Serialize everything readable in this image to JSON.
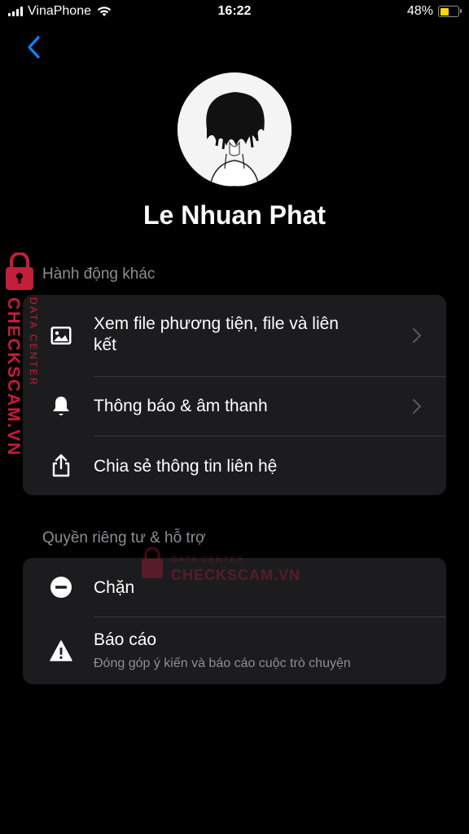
{
  "status_bar": {
    "carrier": "VinaPhone",
    "time": "16:22",
    "battery": "48%",
    "battery_level": 0.48
  },
  "profile": {
    "name": "Le Nhuan Phat"
  },
  "sections": {
    "more_actions": {
      "title": "Hành động khác",
      "items": [
        {
          "label": "Xem file phương tiện, file và liên kết",
          "icon": "image-icon"
        },
        {
          "label": "Thông báo & âm thanh",
          "icon": "bell-icon"
        },
        {
          "label": "Chia sẻ thông tin liên hệ",
          "icon": "share-icon"
        }
      ]
    },
    "privacy": {
      "title": "Quyền riêng tư & hỗ trợ",
      "items": [
        {
          "label": "Chặn",
          "icon": "block-icon"
        },
        {
          "label": "Báo cáo",
          "sublabel": "Đóng góp ý kiến và báo cáo cuộc trò chuyện",
          "icon": "warning-icon"
        }
      ]
    }
  },
  "watermark": {
    "primary": "CHECKSCAM.VN",
    "secondary": "DATA CENTER",
    "color": "#c41e3a"
  },
  "colors": {
    "accent": "#0a84ff",
    "group_bg": "#1c1c1e",
    "secondary_text": "#8e8e93"
  }
}
